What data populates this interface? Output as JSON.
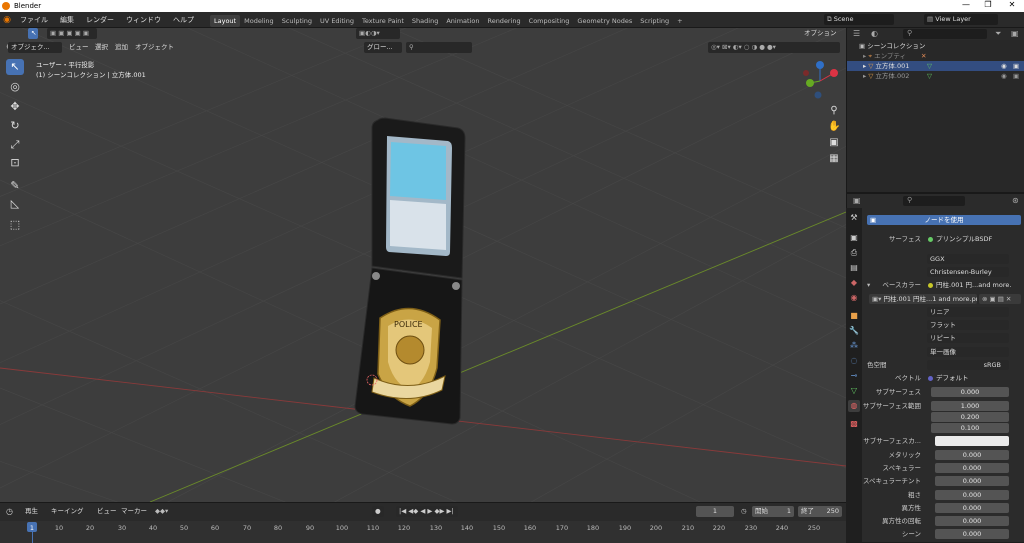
{
  "window": {
    "title": "Blender",
    "minimize": "—",
    "restore": "❐",
    "close": "✕"
  },
  "menu": {
    "items": [
      "ファイル",
      "編集",
      "レンダー",
      "ウィンドウ",
      "ヘルプ"
    ]
  },
  "workspaces": [
    "Layout",
    "Modeling",
    "Sculpting",
    "UV Editing",
    "Texture Paint",
    "Shading",
    "Animation",
    "Rendering",
    "Compositing",
    "Geometry Nodes",
    "Scripting",
    "+"
  ],
  "scene": {
    "scene_name": "Scene",
    "view_layer": "View Layer"
  },
  "viewport_header": {
    "mode": "オブジェク...",
    "menus": [
      "ビュー",
      "選択",
      "追加",
      "オブジェクト"
    ],
    "orientation": "グロー...",
    "options": "オプション"
  },
  "viewport_info": {
    "line1": "ユーザー・平行投影",
    "line2": "(1) シーンコレクション | 立方体.001"
  },
  "badge": {
    "top_text": "POLICE"
  },
  "outliner": {
    "collection": "シーンコレクション",
    "items": [
      "エンプティ",
      "立方体.001",
      "立方体.002"
    ]
  },
  "properties": {
    "use_nodes": "ノードを使用",
    "surface_label": "サーフェス",
    "surface_value": "プリンシプルBSDF",
    "ggx": "GGX",
    "sss_method": "Christensen-Burley",
    "base_color_label": "ベースカラー",
    "base_color_value": "円柱.001 円...and more.pn",
    "image_name": "円柱.001 円柱...1 and more.png",
    "interp": "リニア",
    "proj": "フラット",
    "ext": "リピート",
    "src": "単一画像",
    "colorspace_label": "色空間",
    "colorspace_value": "sRGB",
    "vector_label": "ベクトル",
    "vector_value": "デフォルト",
    "rows": [
      {
        "label": "サブサーフェス",
        "value": "0.000"
      },
      {
        "label": "サブサーフェス範囲",
        "value": "1.000"
      },
      {
        "label": "",
        "value": "0.200"
      },
      {
        "label": "",
        "value": "0.100"
      },
      {
        "label": "サブサーフェスカ...",
        "value": ""
      },
      {
        "label": "メタリック",
        "value": "0.000"
      },
      {
        "label": "スペキュラー",
        "value": "0.000"
      },
      {
        "label": "スペキュラーチント",
        "value": "0.000"
      },
      {
        "label": "粗さ",
        "value": "0.000"
      },
      {
        "label": "異方性",
        "value": "0.000"
      },
      {
        "label": "異方性の回転",
        "value": "0.000"
      },
      {
        "label": "シーン",
        "value": "0.000"
      }
    ]
  },
  "timeline": {
    "menus": [
      "再生",
      "キーイング",
      "ビュー",
      "マーカー"
    ],
    "current_frame": "1",
    "start_label": "開始",
    "start": "1",
    "end_label": "終了",
    "end": "250",
    "ticks": [
      "1",
      "10",
      "20",
      "30",
      "40",
      "50",
      "60",
      "70",
      "80",
      "90",
      "100",
      "110",
      "120",
      "130",
      "140",
      "150",
      "160",
      "170",
      "180",
      "190",
      "200",
      "210",
      "220",
      "230",
      "240",
      "250"
    ]
  }
}
